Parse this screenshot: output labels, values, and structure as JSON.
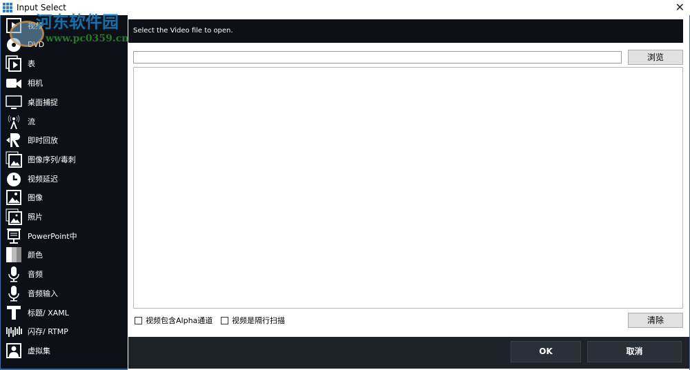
{
  "window": {
    "title": "Input Select",
    "close_glyph": "✕"
  },
  "sidebar": {
    "items": [
      {
        "label": "视频",
        "icon": "video-file-icon"
      },
      {
        "label": "DVD",
        "icon": "dvd-icon"
      },
      {
        "label": "表",
        "icon": "list-play-icon"
      },
      {
        "label": "相机",
        "icon": "camera-icon"
      },
      {
        "label": "桌面捕捉",
        "icon": "monitor-icon"
      },
      {
        "label": "流",
        "icon": "antenna-icon"
      },
      {
        "label": "即时回放",
        "icon": "replay-icon"
      },
      {
        "label": "图像序列/毒刺",
        "icon": "image-stack-icon"
      },
      {
        "label": "视频延迟",
        "icon": "clock-icon"
      },
      {
        "label": "图像",
        "icon": "image-icon"
      },
      {
        "label": "照片",
        "icon": "photos-icon"
      },
      {
        "label": "PowerPoint中",
        "icon": "presentation-icon"
      },
      {
        "label": "颜色",
        "icon": "color-icon"
      },
      {
        "label": "音频",
        "icon": "microphone-icon"
      },
      {
        "label": "音频输入",
        "icon": "microphone-icon"
      },
      {
        "label": "标题/ XAML",
        "icon": "title-icon"
      },
      {
        "label": "闪存/ RTMP",
        "icon": "waveform-icon"
      },
      {
        "label": "虚拟集",
        "icon": "virtual-set-icon"
      }
    ]
  },
  "watermark": {
    "name": "河东软件园",
    "url": "www.pc0359.cn"
  },
  "main": {
    "hint": "Select the Video file to open.",
    "file_path": "",
    "browse_label": "浏览",
    "alpha_checkbox": {
      "label": "视频包含Alpha通道",
      "checked": false
    },
    "interlaced_checkbox": {
      "label": "视频是隔行扫描",
      "checked": false
    },
    "clear_label": "清除"
  },
  "footer": {
    "ok_label": "OK",
    "cancel_label": "取消"
  }
}
